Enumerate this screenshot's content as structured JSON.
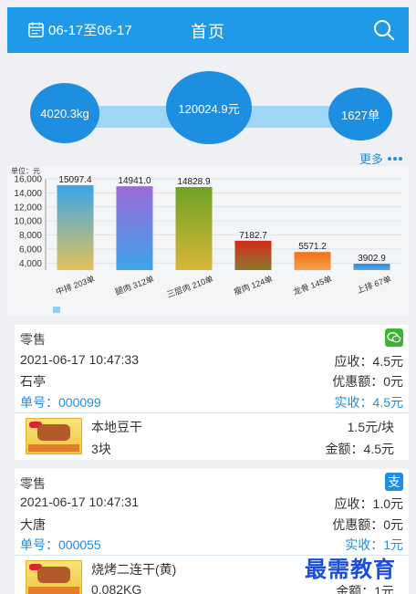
{
  "header": {
    "date_range": "06-17至06-17",
    "title": "首页"
  },
  "summary": {
    "weight": "4020.3kg",
    "amount": "120024.9元",
    "orders": "1627单",
    "more_label": "更多"
  },
  "chart_data": {
    "type": "bar",
    "unit_label": "单位：元",
    "categories": [
      "中排 203单",
      "腿肉 312单",
      "三层肉 210单",
      "瘦肉 124单",
      "龙骨 145单",
      "上排 67单"
    ],
    "values": [
      15097.4,
      14941.0,
      14828.9,
      7182.7,
      5571.2,
      3902.9
    ],
    "ylim": [
      3000,
      16000
    ],
    "yticks": [
      4000,
      6000,
      8000,
      10000,
      12000,
      14000,
      16000
    ],
    "grid": true
  },
  "orders": [
    {
      "type": "零售",
      "pay_method": "wechat-icon",
      "datetime": "2021-06-17 10:47:33",
      "receivable": "应收：4.5元",
      "location": "石亭",
      "discount": "优惠额：0元",
      "order_no": "单号：000099",
      "received": "实收：4.5元",
      "item": {
        "name": "本地豆干",
        "price": "1.5元/块",
        "qty": "3块",
        "amount": "金额：4.5元"
      }
    },
    {
      "type": "零售",
      "pay_method": "alipay-icon",
      "datetime": "2021-06-17 10:47:31",
      "receivable": "应收：1.0元",
      "location": "大唐",
      "discount": "优惠额：0元",
      "order_no": "单号：000055",
      "received": "实收：1元",
      "item": {
        "name": "烧烤二连干(黄)",
        "price": "",
        "qty": "0.082KG",
        "amount": "金额：1元"
      }
    }
  ],
  "watermark": "最需教育",
  "colors": {
    "primary": "#1e9ae8",
    "bubble": "#1e8fe0",
    "wechat": "#3cb534",
    "alipay": "#1e8fe0"
  }
}
